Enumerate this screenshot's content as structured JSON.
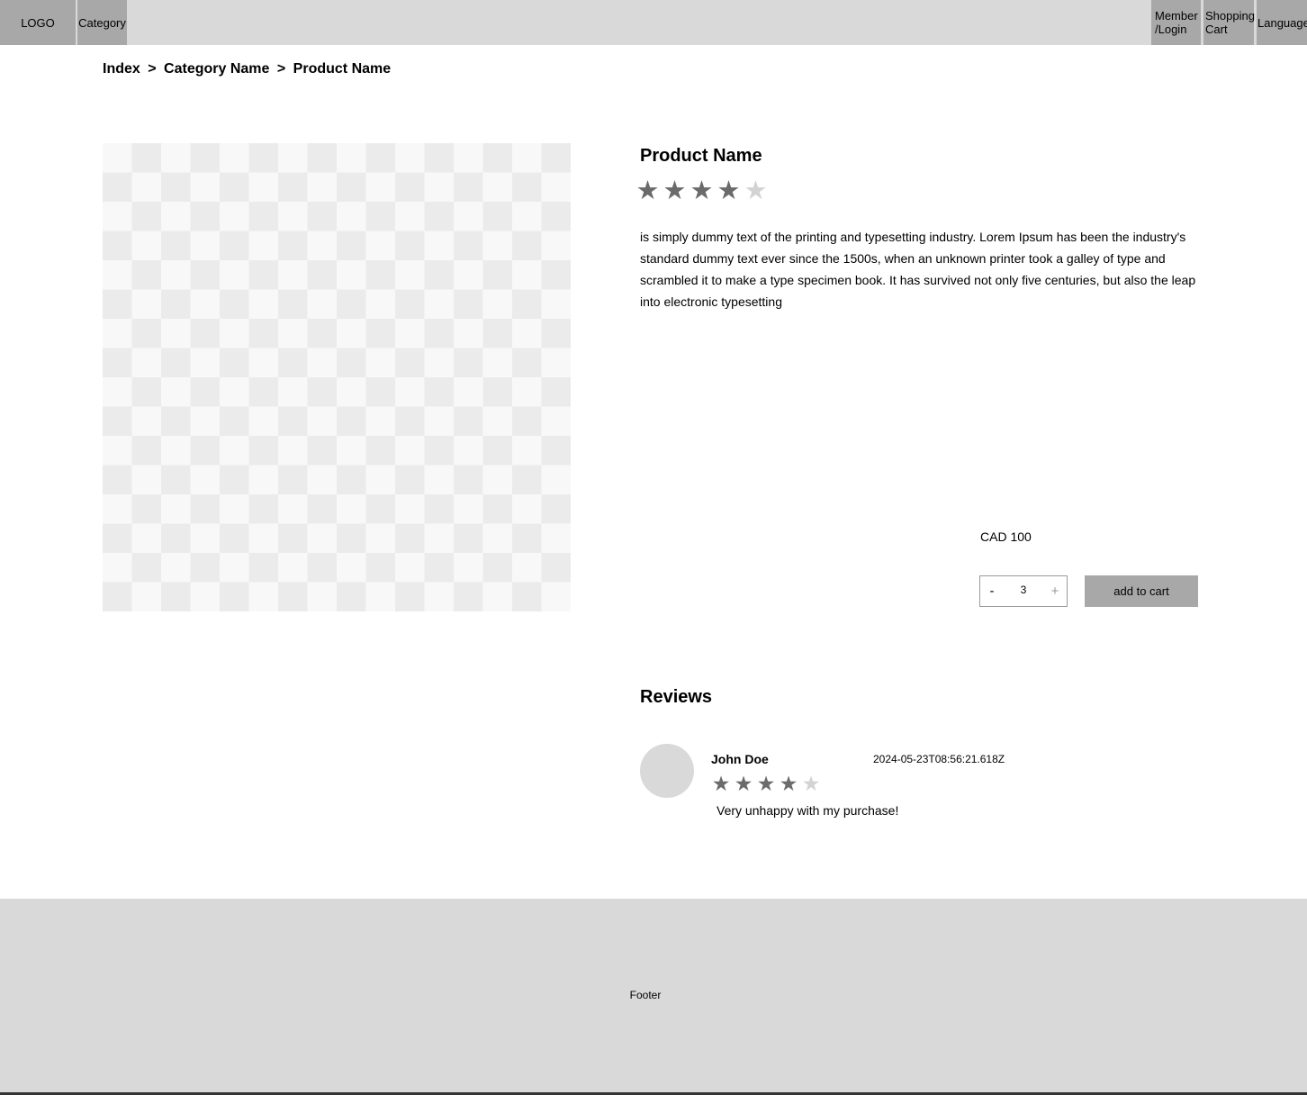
{
  "nav": {
    "logo": "LOGO",
    "category": "Category",
    "member_login": "Member\n/Login",
    "shopping_cart": "Shopping\nCart",
    "language": "Language"
  },
  "breadcrumb": {
    "items": [
      "Index",
      "Category Name",
      "Product Name"
    ],
    "separator": ">"
  },
  "product": {
    "name": "Product Name",
    "rating": 4,
    "rating_max": 5,
    "description": "is simply dummy text of the printing and typesetting industry. Lorem Ipsum has been the industry's standard dummy text ever since the 1500s, when an unknown printer took a galley of type and scrambled it to make a type specimen book. It has survived not only five centuries, but also the leap into electronic typesetting",
    "price": "CAD 100",
    "quantity": "3",
    "minus_label": "-",
    "plus_label": "+",
    "add_to_cart_label": "add to cart"
  },
  "reviews": {
    "title": "Reviews",
    "items": [
      {
        "name": "John Doe",
        "date": "2024-05-23T08:56:21.618Z",
        "rating": 4,
        "rating_max": 5,
        "text": "Very unhappy with my purchase!"
      }
    ]
  },
  "footer": {
    "label": "Footer"
  },
  "colors": {
    "nav_bg": "#d9d9d9",
    "button_bg": "#a8a8a8",
    "star_filled": "#6b6b6b",
    "star_empty": "#d3d3d3"
  },
  "icons": {
    "star": "star-icon",
    "avatar": "avatar-placeholder"
  }
}
